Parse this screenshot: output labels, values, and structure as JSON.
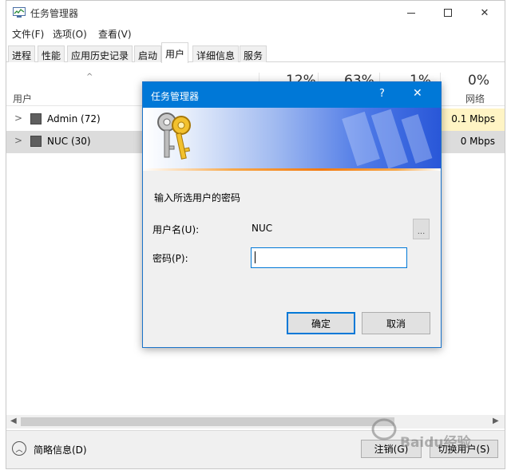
{
  "window": {
    "title": "任务管理器"
  },
  "menu": [
    "文件(F)",
    "选项(O)",
    "查看(V)"
  ],
  "tabs": [
    "进程",
    "性能",
    "应用历史记录",
    "启动",
    "用户",
    "详细信息",
    "服务"
  ],
  "active_tab": "用户",
  "columns": {
    "user": "用户",
    "cpu_pct": "12%",
    "mem_pct": "63%",
    "disk_pct": "1%",
    "net_pct": "0%",
    "net_label": "网络"
  },
  "rows": [
    {
      "name": "Admin (72)",
      "net": "0.1 Mbps"
    },
    {
      "name": "NUC (30)",
      "net": "0 Mbps"
    }
  ],
  "footer": {
    "fewer_details": "简略信息(D)",
    "logoff": "注销(G)",
    "switch_user": "切换用户(S)"
  },
  "dialog": {
    "title": "任务管理器",
    "help": "?",
    "prompt": "输入所选用户的密码",
    "username_label": "用户名(U):",
    "username_value": "NUC",
    "browse": "...",
    "password_label": "密码(P):",
    "password_value": "",
    "ok": "确定",
    "cancel": "取消"
  },
  "watermark": "Baidu经验",
  "colors": {
    "accent": "#0078d7",
    "selected_row": "#dcdcdc",
    "heat": "#fff4c4"
  }
}
